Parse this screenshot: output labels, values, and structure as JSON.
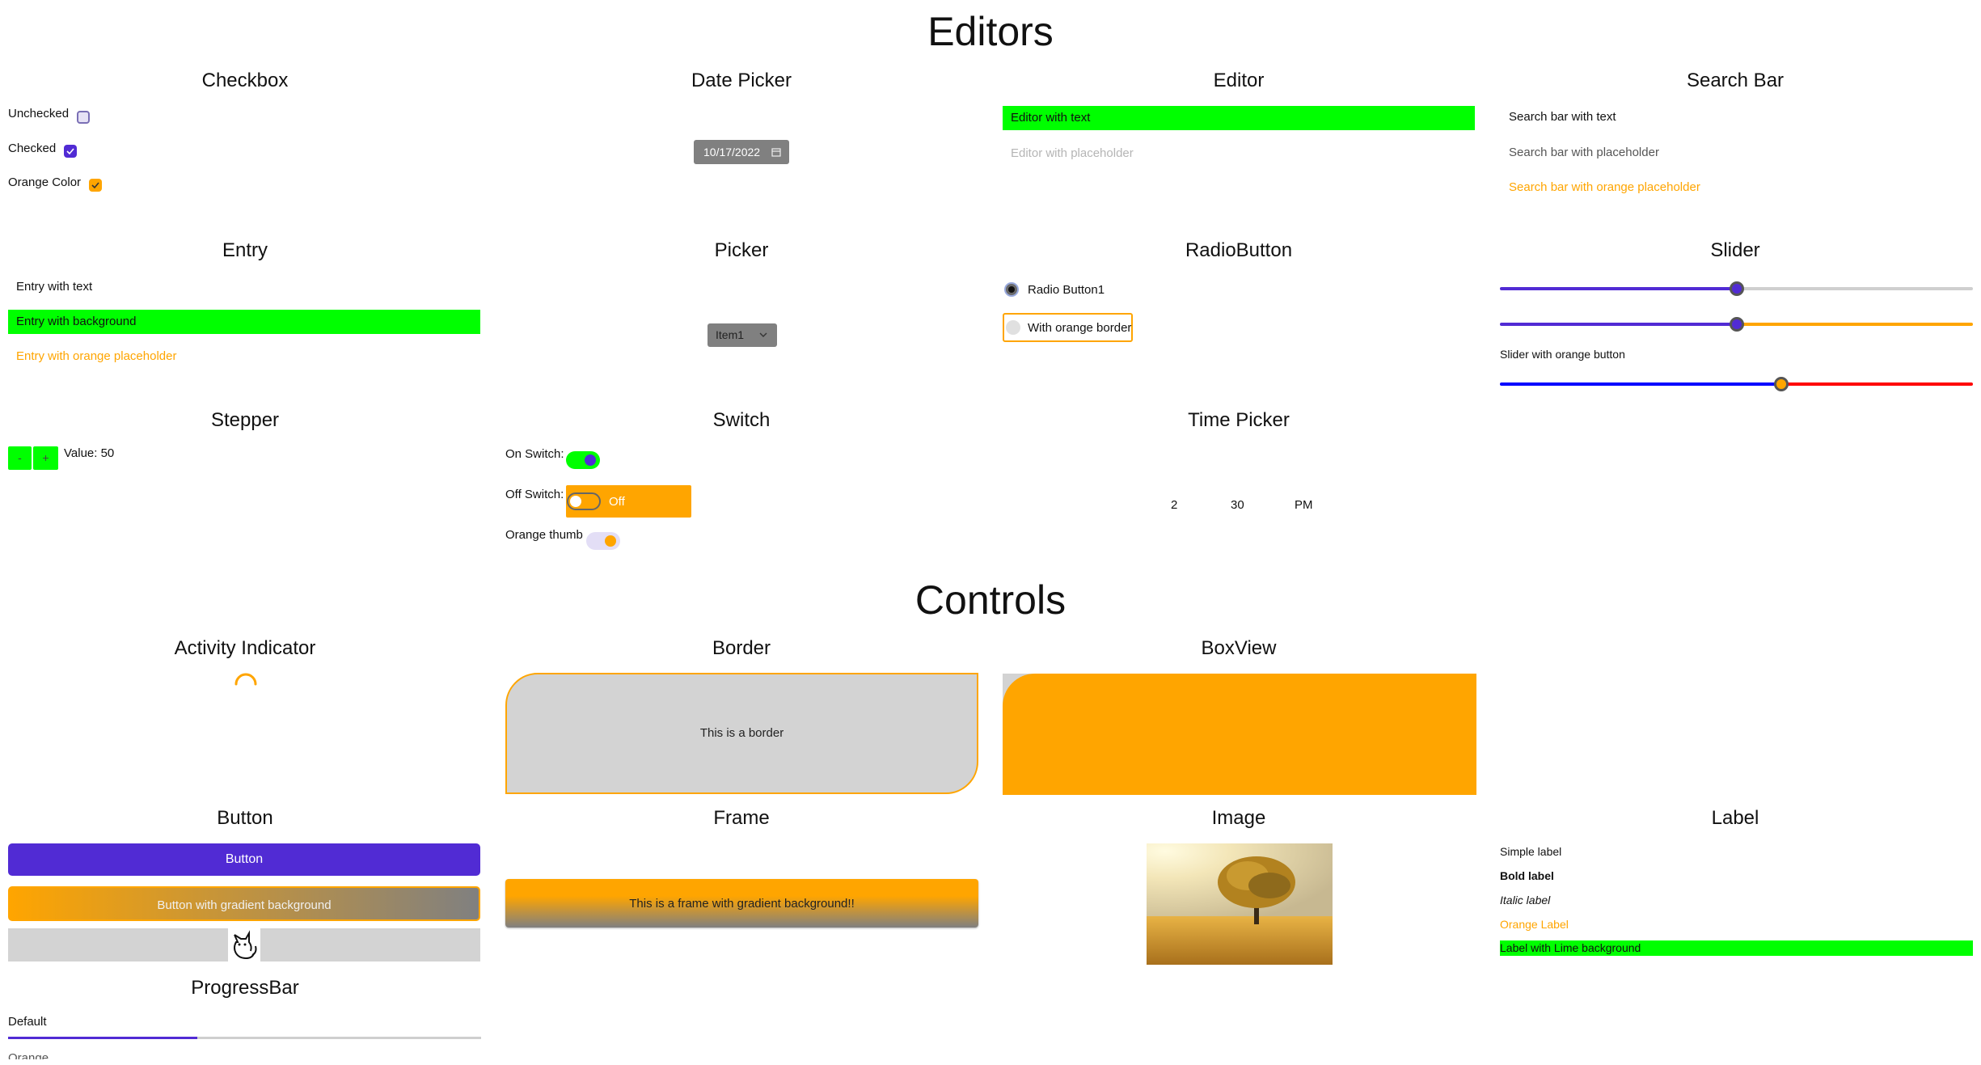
{
  "headings": {
    "editors": "Editors",
    "controls": "Controls"
  },
  "sections": {
    "checkbox": "Checkbox",
    "date_picker": "Date Picker",
    "editor": "Editor",
    "search_bar": "Search Bar",
    "entry": "Entry",
    "picker": "Picker",
    "radio_button": "RadioButton",
    "slider": "Slider",
    "stepper": "Stepper",
    "switch": "Switch",
    "time_picker": "Time Picker",
    "activity_indicator": "Activity Indicator",
    "border": "Border",
    "boxview": "BoxView",
    "button": "Button",
    "frame": "Frame",
    "image": "Image",
    "label": "Label",
    "progressbar": "ProgressBar"
  },
  "checkbox": {
    "unchecked_label": "Unchecked",
    "checked_label": "Checked",
    "orange_label": "Orange Color",
    "unchecked_value": false,
    "checked_value": true,
    "orange_value": true
  },
  "date_picker": {
    "value": "10/17/2022",
    "icon": "calendar-icon"
  },
  "editor": {
    "text_value": "Editor with text",
    "placeholder": "Editor with placeholder"
  },
  "search_bar": {
    "text_value": "Search bar with text",
    "placeholder": "Search bar with placeholder",
    "orange_placeholder": "Search bar with orange placeholder"
  },
  "entry": {
    "text_value": "Entry with text",
    "background_value": "Entry with background",
    "orange_placeholder": "Entry with orange placeholder"
  },
  "picker": {
    "selected": "Item1",
    "icon": "chevron-down-icon"
  },
  "radio": {
    "button1_label": "Radio Button1",
    "orange_border_label": "With orange border",
    "button1_checked": true
  },
  "slider": {
    "slider1_value": 0.5,
    "slider2_value": 0.5,
    "orange_button_label": "Slider with orange button",
    "slider3_value": 0.595
  },
  "stepper": {
    "minus": "-",
    "plus": "+",
    "value_text": "Value: 50"
  },
  "switch": {
    "on_label": "On Switch:",
    "off_label": "Off Switch:",
    "off_text": "Off",
    "orange_thumb_label": "Orange thumb",
    "on_value": true,
    "off_value": false
  },
  "time_picker": {
    "hour": "2",
    "minute": "30",
    "ampm": "PM"
  },
  "border": {
    "text": "This is a border"
  },
  "button": {
    "label": "Button",
    "gradient_label": "Button with gradient background",
    "image_icon": "cat-icon"
  },
  "frame": {
    "text": "This is a frame with gradient background!!"
  },
  "image": {
    "description_icon": "tree-field-image"
  },
  "labels": {
    "simple": "Simple label",
    "bold": "Bold label",
    "italic": "Italic label",
    "orange": "Orange Label",
    "lime_bg": "Label with Lime background"
  },
  "progressbar": {
    "default_label": "Default",
    "default_value": 0.4,
    "orange_label": "Orange"
  },
  "colors": {
    "accent": "#512BD4",
    "lime": "#00FF00",
    "orange": "#FFA500",
    "gray": "#808080",
    "light_gray": "#D3D3D3",
    "blue": "#0000FF",
    "red": "#FF0000"
  }
}
